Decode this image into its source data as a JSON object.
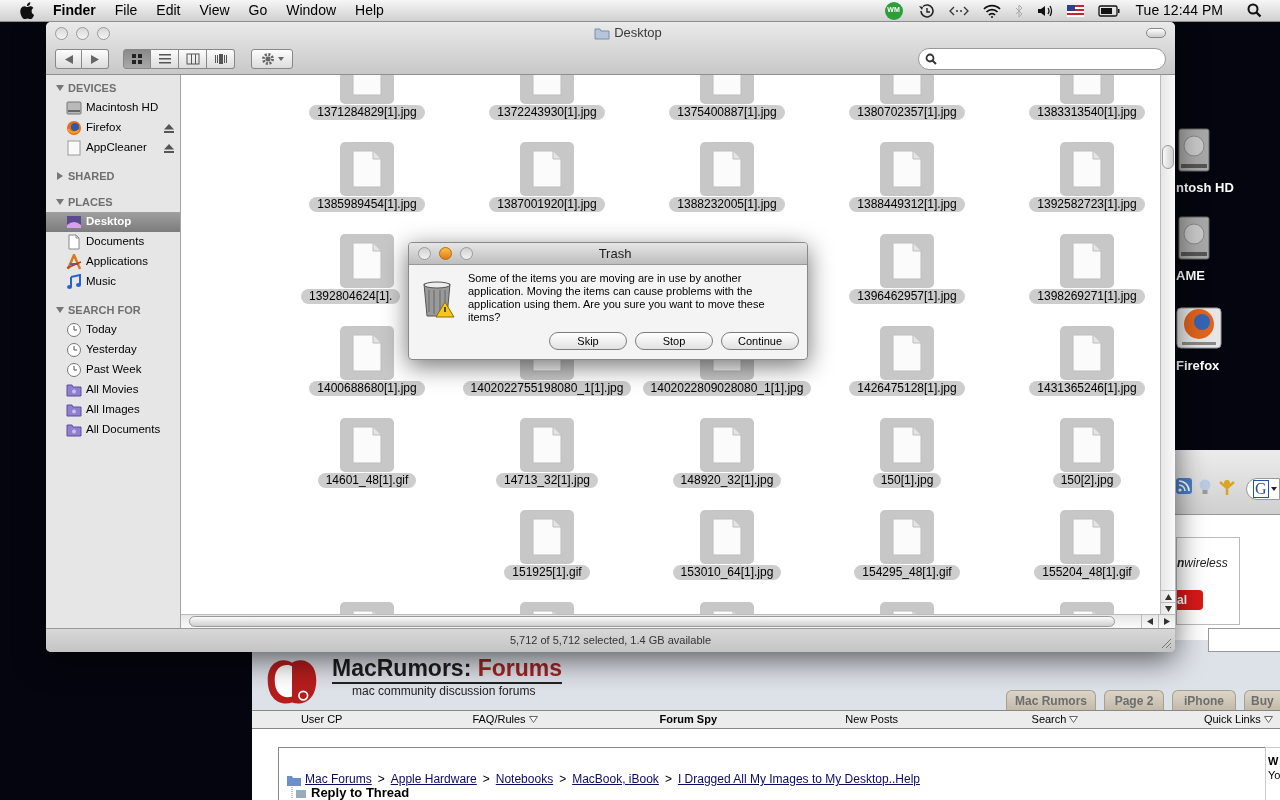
{
  "menu_bar": {
    "app": "Finder",
    "menus": [
      "File",
      "Edit",
      "View",
      "Go",
      "Window",
      "Help"
    ],
    "status_badge": "WM",
    "clock": "Tue 12:44 PM"
  },
  "desktop_icons": [
    {
      "label": "ntosh HD",
      "kind": "drive"
    },
    {
      "label": "AME",
      "kind": "drive"
    },
    {
      "label": "Firefox",
      "kind": "firefox"
    }
  ],
  "finder": {
    "title": "Desktop",
    "views": [
      {
        "kind": "icons",
        "selected": true
      },
      {
        "kind": "list",
        "selected": false
      },
      {
        "kind": "columns",
        "selected": false
      },
      {
        "kind": "coverflow",
        "selected": false
      }
    ],
    "sidebar": [
      {
        "heading": "DEVICES",
        "expanded": true,
        "items": [
          {
            "label": "Macintosh HD",
            "kind": "drive",
            "eject": false,
            "selected": false
          },
          {
            "label": "Firefox",
            "kind": "firefox",
            "eject": true,
            "selected": false
          },
          {
            "label": "AppCleaner",
            "kind": "disk",
            "eject": true,
            "selected": false
          }
        ]
      },
      {
        "heading": "SHARED",
        "expanded": false
      },
      {
        "heading": "PLACES",
        "expanded": true,
        "items": [
          {
            "label": "Desktop",
            "kind": "desktop",
            "eject": false,
            "selected": true
          },
          {
            "label": "Documents",
            "kind": "documents",
            "eject": false,
            "selected": false
          },
          {
            "label": "Applications",
            "kind": "applications",
            "eject": false,
            "selected": false
          },
          {
            "label": "Music",
            "kind": "music",
            "eject": false,
            "selected": false
          }
        ]
      },
      {
        "heading": "SEARCH FOR",
        "expanded": true,
        "items": [
          {
            "label": "Today",
            "kind": "clock",
            "eject": false,
            "selected": false
          },
          {
            "label": "Yesterday",
            "kind": "clock",
            "eject": false,
            "selected": false
          },
          {
            "label": "Past Week",
            "kind": "clock",
            "eject": false,
            "selected": false
          },
          {
            "label": "All Movies",
            "kind": "smart-folder",
            "eject": false,
            "selected": false
          },
          {
            "label": "All Images",
            "kind": "smart-folder",
            "eject": false,
            "selected": false
          },
          {
            "label": "All Documents",
            "kind": "smart-folder",
            "eject": false,
            "selected": false
          }
        ]
      }
    ],
    "files": [
      [
        {
          "kind": "file",
          "name": "1371284829[1].jpg",
          "selected": true
        },
        {
          "kind": "file",
          "name": "1372243930[1].jpg",
          "selected": true
        },
        {
          "kind": "file",
          "name": "1375400887[1].jpg",
          "selected": true
        },
        {
          "kind": "file",
          "name": "1380702357[1].jpg",
          "selected": true
        },
        {
          "kind": "file",
          "name": "1383313540[1].jpg",
          "selected": true
        }
      ],
      [
        {
          "kind": "file",
          "name": "1385989454[1].jpg",
          "selected": true
        },
        {
          "kind": "file",
          "name": "1387001920[1].jpg",
          "selected": true
        },
        {
          "kind": "file",
          "name": "1388232005[1].jpg",
          "selected": true
        },
        {
          "kind": "file",
          "name": "1388449312[1].jpg",
          "selected": true
        },
        {
          "kind": "file",
          "name": "1392582723[1].jpg",
          "selected": true
        }
      ],
      [
        {
          "kind": "cut",
          "name": "1392804624[1].",
          "selected": true
        },
        {
          "kind": "hidden"
        },
        {
          "kind": "hidden"
        },
        {
          "kind": "file",
          "name": "1396462957[1].jpg",
          "selected": true
        },
        {
          "kind": "file",
          "name": "1398269271[1].jpg",
          "selected": true
        }
      ],
      [
        {
          "kind": "file",
          "name": "1400688680[1].jpg",
          "selected": true
        },
        {
          "kind": "file",
          "name": "1402022755198080_1[1].jpg",
          "selected": true
        },
        {
          "kind": "file",
          "name": "1402022809028080_1[1].jpg",
          "selected": true
        },
        {
          "kind": "file",
          "name": "1426475128[1].jpg",
          "selected": true
        },
        {
          "kind": "file",
          "name": "1431365246[1].jpg",
          "selected": true
        }
      ],
      [
        {
          "kind": "file",
          "name": "14601_48[1].gif",
          "selected": true
        },
        {
          "kind": "file",
          "name": "14713_32[1].jpg",
          "selected": true
        },
        {
          "kind": "file",
          "name": "148920_32[1].jpg",
          "selected": true
        },
        {
          "kind": "file",
          "name": "150[1].jpg",
          "selected": true
        },
        {
          "kind": "file",
          "name": "150[2].jpg",
          "selected": true
        }
      ],
      [
        {
          "kind": "empty"
        },
        {
          "kind": "file",
          "name": "151925[1].gif",
          "selected": true
        },
        {
          "kind": "file",
          "name": "153010_64[1].jpg",
          "selected": true
        },
        {
          "kind": "file",
          "name": "154295_48[1].gif",
          "selected": true
        },
        {
          "kind": "file",
          "name": "155204_48[1].gif",
          "selected": true
        }
      ],
      [
        {
          "kind": "icon_only",
          "selected": true
        },
        {
          "kind": "icon_only",
          "selected": true
        },
        {
          "kind": "icon_only",
          "selected": true
        },
        {
          "kind": "icon_only",
          "selected": true
        },
        {
          "kind": "icon_only",
          "selected": true
        }
      ]
    ],
    "status_bar": "5,712 of 5,712 selected, 1.4 GB available"
  },
  "dialog": {
    "title": "Trash",
    "message": "Some of the items you are moving are in use by another application. Moving the items can cause problems with the application using them. Are you sure you want to move these items?",
    "buttons": [
      "Skip",
      "Stop",
      "Continue"
    ]
  },
  "browser": {
    "search_engine": "G",
    "ad": {
      "text": "**n**wireless",
      "button": "al"
    },
    "site": {
      "name": "MacRumors:",
      "section": "Forums",
      "tagline": "mac community discussion forums"
    },
    "tabs": [
      "Mac Rumors",
      "Page 2",
      "iPhone",
      "Buy"
    ],
    "nav": [
      {
        "label": "User CP",
        "menu": false,
        "emphasized": false
      },
      {
        "label": "FAQ/Rules",
        "menu": true,
        "emphasized": false
      },
      {
        "label": "Forum Spy",
        "menu": false,
        "emphasized": true
      },
      {
        "label": "New Posts",
        "menu": false,
        "emphasized": false
      },
      {
        "label": "Search",
        "menu": true,
        "emphasized": false
      },
      {
        "label": "Quick Links",
        "menu": true,
        "emphasized": false
      }
    ],
    "breadcrumbs": [
      {
        "kind": "link",
        "text": "Mac Forums"
      },
      {
        "kind": "separator",
        "text": ">"
      },
      {
        "kind": "link",
        "text": "Apple Hardware"
      },
      {
        "kind": "separator",
        "text": ">"
      },
      {
        "kind": "link",
        "text": "Notebooks"
      },
      {
        "kind": "separator",
        "text": ">"
      },
      {
        "kind": "link",
        "text": "MacBook, iBook"
      },
      {
        "kind": "separator",
        "text": ">"
      },
      {
        "kind": "link",
        "text": "I Dragged All My Images to My Desktop..Help"
      }
    ],
    "heading": "Reply to Thread",
    "side_text": [
      "W",
      "Yo"
    ]
  }
}
